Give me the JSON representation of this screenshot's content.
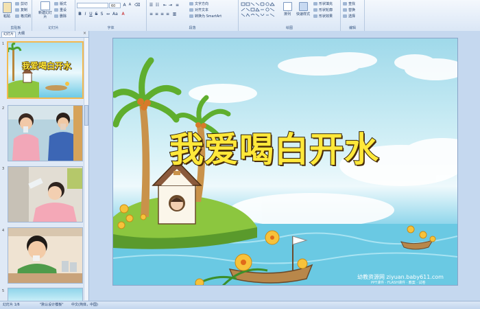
{
  "ribbon": {
    "clipboard": {
      "label": "剪贴板",
      "paste": "粘贴",
      "cut": "剪切",
      "copy": "复制",
      "format_painter": "格式刷"
    },
    "slides": {
      "label": "幻灯片",
      "new_slide": "新建幻灯片",
      "layout": "版式",
      "reset": "重设",
      "delete": "删除"
    },
    "font": {
      "label": "字体",
      "size": "60"
    },
    "paragraph": {
      "label": "段落",
      "text_direction": "文字方向",
      "align_text": "对齐文本",
      "smartart": "转换为 SmartArt"
    },
    "drawing": {
      "label": "绘图",
      "arrange": "排列",
      "quick_styles": "快速样式",
      "shape_fill": "形状填充",
      "shape_outline": "形状轮廓",
      "shape_effects": "形状效果"
    },
    "editing": {
      "label": "编辑",
      "find": "查找",
      "replace": "替换",
      "select": "选择"
    }
  },
  "left_pane": {
    "tabs": [
      "幻灯片",
      "大纲"
    ],
    "close": "×",
    "thumbnails": [
      {
        "num": "1",
        "label": "我爱喝白开水",
        "selected": true
      },
      {
        "num": "2",
        "selected": false
      },
      {
        "num": "3",
        "selected": false
      },
      {
        "num": "4",
        "selected": false
      },
      {
        "num": "5",
        "selected": false
      }
    ]
  },
  "slide": {
    "title": "我爱喝白开水",
    "watermark_main": "幼教资源网 ziyuan.baby611.com",
    "watermark_sub": "PPT课件 · FLASH课件 · 教案 · 试卷"
  },
  "status": {
    "slide_count": "幻灯片 1/6",
    "theme": "\"默认设计模板\"",
    "language": "中文(简体，中国)"
  },
  "colors": {
    "ribbon_bg": "#dbe7f6",
    "accent": "#f3b84f",
    "title_fill": "#ffe83a",
    "sea": "#5cc0df"
  }
}
